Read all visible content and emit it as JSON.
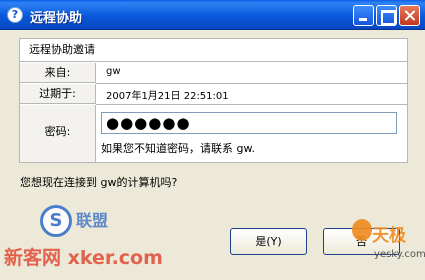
{
  "window": {
    "title": "远程协助"
  },
  "invitation": {
    "header": "远程协助邀请",
    "from_label": "来自:",
    "from_value": "gw",
    "expires_label": "过期于:",
    "expires_value": "2007年1月21日 22:51:01",
    "password_label": "密码:",
    "password_value": "●●●●●●",
    "password_hint": "如果您不知道密码，请联系 gw."
  },
  "question": "您想现在连接到 gw的计算机吗?",
  "buttons": {
    "yes": "是(Y)",
    "no": "否"
  },
  "watermarks": {
    "site_left": "新客网",
    "site_left_url": "xker.com",
    "badge": "S",
    "lianmeng": "联盟",
    "site_right": "天极",
    "site_right_url": "yesky.com"
  }
}
